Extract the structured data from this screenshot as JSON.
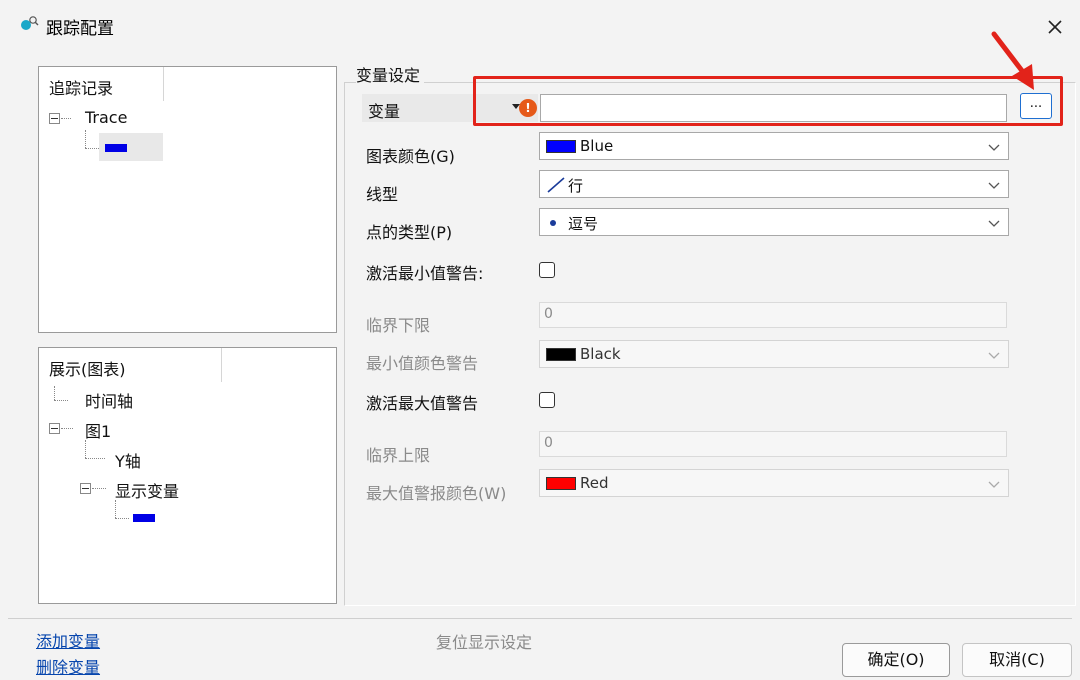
{
  "window": {
    "title": "跟踪配置"
  },
  "trace_panel": {
    "header": "追踪记录",
    "root": "Trace"
  },
  "display_panel": {
    "header": "展示(图表)",
    "items": [
      "时间轴",
      "图1",
      "Y轴",
      "显示变量"
    ]
  },
  "variable_settings": {
    "group_title": "变量设定",
    "variable": {
      "label": "变量",
      "value": "",
      "browse_label": "..."
    },
    "chart_color": {
      "label": "图表颜色(G)",
      "value": "Blue",
      "color": "#0000ff"
    },
    "line_type": {
      "label": "线型",
      "value": "行"
    },
    "point_type": {
      "label": "点的类型(P)",
      "value": "逗号"
    },
    "min_warning": {
      "label": "激活最小值警告:",
      "checked": false
    },
    "lower_limit": {
      "label": "临界下限",
      "value": "0"
    },
    "min_color": {
      "label": "最小值颜色警告",
      "value": "Black",
      "color": "#000000"
    },
    "max_warning": {
      "label": "激活最大值警告",
      "checked": false
    },
    "upper_limit": {
      "label": "临界上限",
      "value": "0"
    },
    "max_color": {
      "label": "最大值警报颜色(W)",
      "value": "Red",
      "color": "#ff0000"
    }
  },
  "footer": {
    "add_variable": "添加变量",
    "delete_variable": "删除变量",
    "reset_display": "复位显示设定",
    "ok": "确定(O)",
    "cancel": "取消(C)"
  },
  "colors": {
    "trace_swatch": "#0000e6",
    "highlight": "#e2231a",
    "accent_border": "#1f6fd1"
  }
}
